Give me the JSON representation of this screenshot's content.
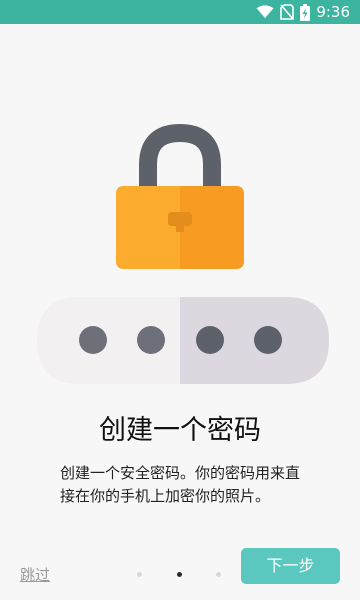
{
  "status_bar": {
    "time": "9:36",
    "icons": [
      "wifi-icon",
      "no-sim-icon",
      "battery-charging-icon"
    ]
  },
  "onboarding": {
    "title": "创建一个密码",
    "description": "创建一个安全密码。你的密码用来直接在你的手机上加密你的照片。",
    "skip_label": "跳过",
    "next_label": "下一步",
    "page_indicator": {
      "total": 3,
      "current": 2
    }
  },
  "colors": {
    "status_bar": "#3db4a0",
    "lock_body_left": "#fbab2d",
    "lock_body_right": "#f89b22",
    "shackle": "#5d6169",
    "pill_left": "#f3f0f2",
    "pill_right": "#ddd8df",
    "next_button": "#5bc8c0"
  }
}
